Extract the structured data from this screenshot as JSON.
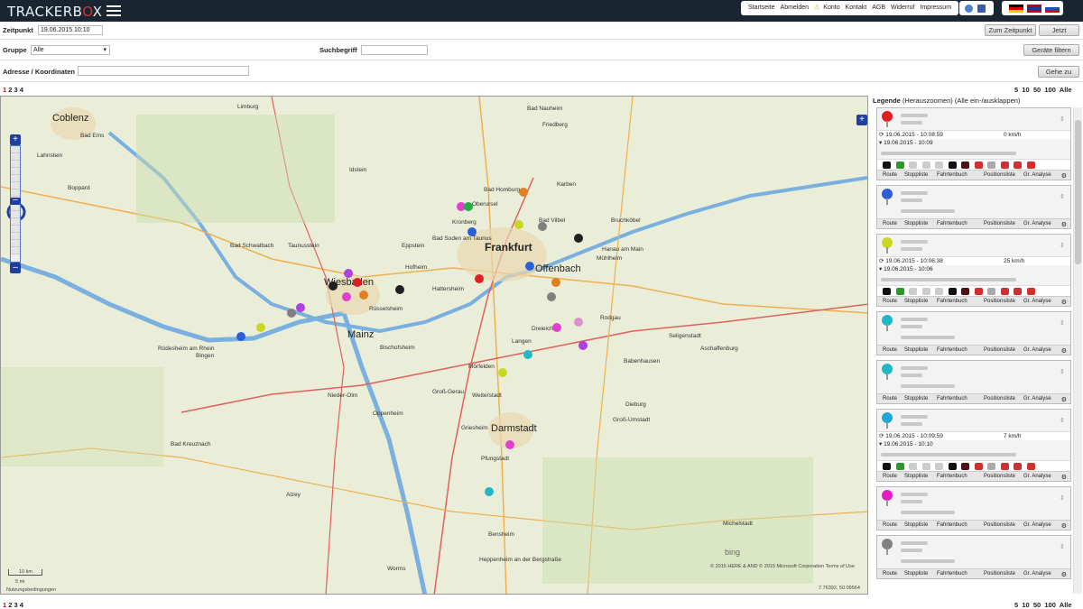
{
  "app": {
    "logo_text": "TRACKERB",
    "logo_eye": "O",
    "logo_end": "X"
  },
  "nav": [
    "Startseite",
    "Abmelden",
    "Konto",
    "Kontakt",
    "AGB",
    "Widerruf",
    "Impressum"
  ],
  "filters": {
    "zeitpunkt_label": "Zeitpunkt",
    "zeitpunkt_value": "19.06.2015 10:10",
    "zum_zeitpunkt": "Zum Zeitpunkt",
    "jetzt": "Jetzt",
    "gruppe_label": "Gruppe",
    "gruppe_value": "Alle",
    "suchbegriff_label": "Suchbegriff",
    "geraete_filtern": "Geräte filtern",
    "adresse_label": "Adresse / Koordinaten",
    "gehe_zu": "Gehe zu"
  },
  "pagination": {
    "pages": [
      "1",
      "2",
      "3",
      "4"
    ],
    "sizes": [
      "5",
      "10",
      "50",
      "100",
      "Alle"
    ]
  },
  "map": {
    "labels": [
      {
        "t": "Frankfurt",
        "c": "big"
      },
      {
        "t": "Mainz",
        "c": "city"
      },
      {
        "t": "Darmstadt",
        "c": "city"
      },
      {
        "t": "Coblenz",
        "c": "city"
      },
      {
        "t": "Offenbach",
        "c": "city"
      },
      {
        "t": "Wiesbaden",
        "c": "city"
      },
      {
        "t": "Hanau am Main",
        "c": ""
      },
      {
        "t": "Bad Homburg",
        "c": ""
      },
      {
        "t": "Oberursel",
        "c": ""
      },
      {
        "t": "Bad Vilbel",
        "c": ""
      },
      {
        "t": "Rüsselsheim",
        "c": ""
      },
      {
        "t": "Bingen",
        "c": ""
      },
      {
        "t": "Rüdesheim am Rhein",
        "c": ""
      },
      {
        "t": "Bad Kreuznach",
        "c": ""
      },
      {
        "t": "Worms",
        "c": ""
      },
      {
        "t": "Aschaffenburg",
        "c": ""
      },
      {
        "t": "Langen",
        "c": ""
      },
      {
        "t": "Dreieich",
        "c": ""
      },
      {
        "t": "Groß-Gerau",
        "c": ""
      },
      {
        "t": "Pfungstadt",
        "c": ""
      },
      {
        "t": "Bensheim",
        "c": ""
      },
      {
        "t": "Heppenheim an der Bergstraße",
        "c": ""
      },
      {
        "t": "Dieburg",
        "c": ""
      },
      {
        "t": "Groß-Umstadt",
        "c": ""
      },
      {
        "t": "Friedberg",
        "c": ""
      },
      {
        "t": "Bad Nauheim",
        "c": ""
      },
      {
        "t": "Idstein",
        "c": ""
      },
      {
        "t": "Taunusstein",
        "c": ""
      },
      {
        "t": "Bad Schwalbach",
        "c": ""
      },
      {
        "t": "Limburg",
        "c": ""
      },
      {
        "t": "Alzey",
        "c": ""
      },
      {
        "t": "Bad Ems",
        "c": ""
      },
      {
        "t": "Rodgau",
        "c": ""
      },
      {
        "t": "Mühlheim",
        "c": ""
      },
      {
        "t": "Karben",
        "c": ""
      },
      {
        "t": "Bruchköbel",
        "c": ""
      },
      {
        "t": "Bad Soden am Taunus",
        "c": ""
      },
      {
        "t": "Kronberg",
        "c": ""
      },
      {
        "t": "Hattersheim",
        "c": ""
      },
      {
        "t": "Eppstein",
        "c": ""
      },
      {
        "t": "Hofheim",
        "c": ""
      },
      {
        "t": "Bischofsheim",
        "c": ""
      },
      {
        "t": "Griesheim",
        "c": ""
      },
      {
        "t": "Weiterstadt",
        "c": ""
      },
      {
        "t": "Mörfelden",
        "c": ""
      },
      {
        "t": "Nieder-Olm",
        "c": ""
      },
      {
        "t": "Oppenheim",
        "c": ""
      },
      {
        "t": "Seligenstadt",
        "c": ""
      },
      {
        "t": "Babenhausen",
        "c": ""
      },
      {
        "t": "Michelstadt",
        "c": ""
      },
      {
        "t": "Boppard",
        "c": ""
      },
      {
        "t": "Lahnstein",
        "c": ""
      }
    ],
    "attribution": "© 2015 HERE & AND © 2015 Microsoft Corporation Terms of Use",
    "bing": "bing",
    "scale_km": "10 km",
    "scale_mi": "5 mi",
    "terms": "Nutzungsbedingungen",
    "coords": "7.76392, 50.09564"
  },
  "legend": {
    "title": "Legende",
    "subtitle": "(Herauszoomen) (Alle ein-/ausklappen)",
    "tabs": [
      "Route",
      "Stoppliste",
      "Fahrtenbuch",
      "Positionsliste",
      "Gr. Analyse"
    ],
    "cards": [
      {
        "color": "#e02020",
        "time1": "19.06.2015 - 10:08:59",
        "speed": "0 km/h",
        "time2": "19.06.2015 - 10:09",
        "detail": true
      },
      {
        "color": "#2a5fd8",
        "detail": false
      },
      {
        "color": "#c8d820",
        "time1": "19.06.2015 - 10:06:38",
        "speed": "25 km/h",
        "time2": "19.06.2015 - 10:06",
        "detail": true
      },
      {
        "color": "#20b8c8",
        "detail": false
      },
      {
        "color": "#20b8c8",
        "detail": false
      },
      {
        "color": "#20a8d8",
        "time1": "19.06.2015 - 10:09:59",
        "speed": "7 km/h",
        "time2": "19.06.2015 - 10:10",
        "detail": true
      },
      {
        "color": "#e020c0",
        "detail": false
      },
      {
        "color": "#808080",
        "detail": false
      }
    ]
  },
  "colors": {
    "topbar": "#1a2532",
    "accent_red": "#d00000"
  }
}
